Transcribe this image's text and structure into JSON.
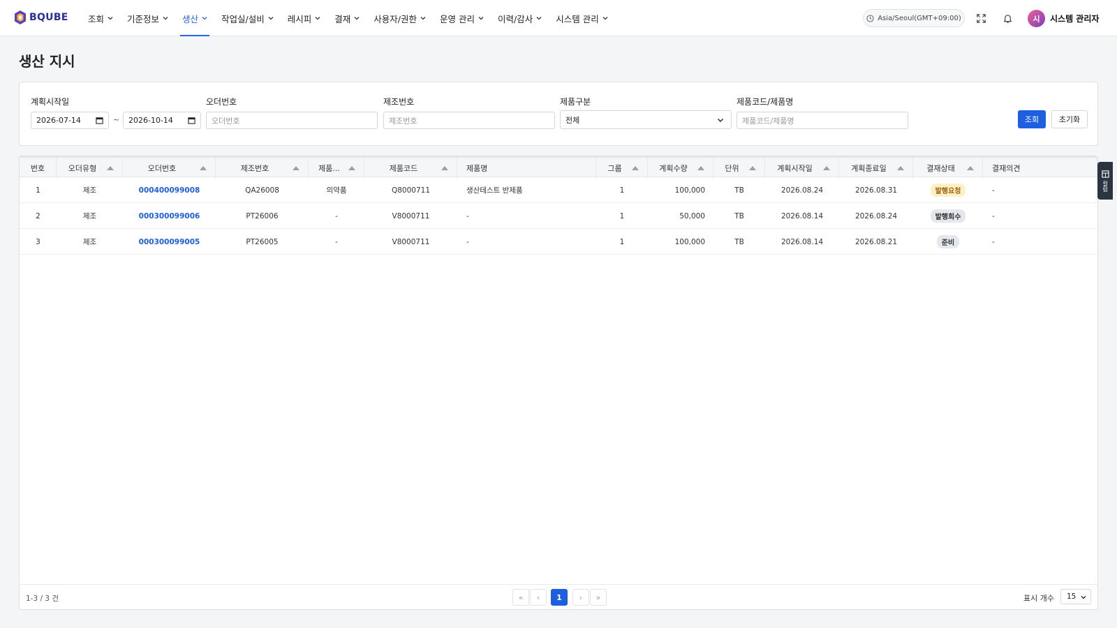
{
  "brand": {
    "name": "BQUBE"
  },
  "nav": {
    "items": [
      {
        "label": "조회"
      },
      {
        "label": "기준정보"
      },
      {
        "label": "생산"
      },
      {
        "label": "작업실/설비"
      },
      {
        "label": "레시피"
      },
      {
        "label": "결재"
      },
      {
        "label": "사용자/권한"
      },
      {
        "label": "운영 관리"
      },
      {
        "label": "이력/감사"
      },
      {
        "label": "시스템 관리"
      }
    ],
    "active_index": 2,
    "timezone": "Asia/Seoul(GMT+09:00)",
    "user_initial": "시",
    "user_name": "시스템 관리자",
    "accent": "#2563eb"
  },
  "page": {
    "title": "생산 지시"
  },
  "filters": {
    "plan_start_label": "계획시작일",
    "date_from": "2026-07-14",
    "date_sep": "~",
    "date_to": "2026-10-14",
    "order_no_label": "오더번호",
    "order_no_placeholder": "오더번호",
    "mfg_no_label": "제조번호",
    "mfg_no_placeholder": "제조번호",
    "product_type_label": "제품구분",
    "product_type_value": "전체",
    "product_code_label": "제품코드/제품명",
    "product_code_placeholder": "제품코드/제품명",
    "search_button": "조회",
    "reset_button": "초기화"
  },
  "table": {
    "columns": [
      "번호",
      "오더유형",
      "오더번호",
      "제조번호",
      "제품...",
      "제품코드",
      "제품명",
      "그룹",
      "계획수량",
      "단위",
      "계획시작일",
      "계획종료일",
      "결재상태",
      "결재의견"
    ],
    "rows": [
      {
        "no": "1",
        "order_type": "제조",
        "order_no": "000400099008",
        "mfg_no": "QA26008",
        "product_type": "의약품",
        "product_code": "Q8000711",
        "product_name": "생산테스트 반제품",
        "group": "1",
        "qty": "100,000",
        "unit": "TB",
        "start": "2026.08.24",
        "end": "2026.08.31",
        "status": "발행요청",
        "status_color": "#fdf0c7",
        "status_text_color": "#a0620a",
        "opinion": "-"
      },
      {
        "no": "2",
        "order_type": "제조",
        "order_no": "000300099006",
        "mfg_no": "PT26006",
        "product_type": "-",
        "product_code": "V8000711",
        "product_name": "-",
        "group": "1",
        "qty": "50,000",
        "unit": "TB",
        "start": "2026.08.14",
        "end": "2026.08.24",
        "status": "발행회수",
        "status_color": "#e4e7ec",
        "status_text_color": "#333333",
        "opinion": "-"
      },
      {
        "no": "3",
        "order_type": "제조",
        "order_no": "000300099005",
        "mfg_no": "PT26005",
        "product_type": "-",
        "product_code": "V8000711",
        "product_name": "-",
        "group": "1",
        "qty": "100,000",
        "unit": "TB",
        "start": "2026.08.14",
        "end": "2026.08.21",
        "status": "준비",
        "status_color": "#e4e7ec",
        "status_text_color": "#333333",
        "opinion": "-"
      }
    ]
  },
  "footer": {
    "count_text": "1-3 / 3 건",
    "first": "«",
    "prev": "‹",
    "current_page": "1",
    "next": "›",
    "last": "»",
    "page_size_label": "표시 개수",
    "page_size": "15"
  },
  "side_panel": {
    "label": "컬럼"
  }
}
